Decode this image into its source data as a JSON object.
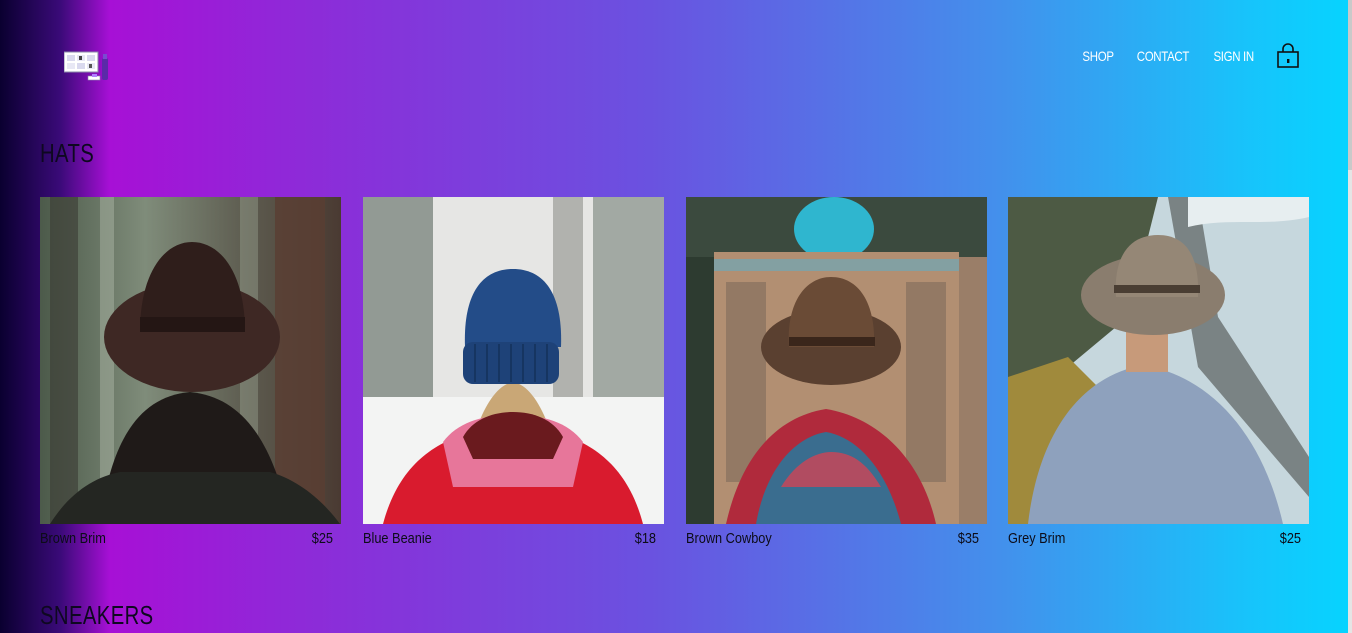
{
  "nav": {
    "shop": "SHOP",
    "contact": "CONTACT",
    "sign_in": "SIGN IN",
    "bag_icon": "shopping-bag-icon"
  },
  "logo": {
    "icon": "storefront-logo-icon"
  },
  "sections": [
    {
      "title": "HATS",
      "items": [
        {
          "name": "Brown Brim",
          "price": "$25"
        },
        {
          "name": "Blue Beanie",
          "price": "$18"
        },
        {
          "name": "Brown Cowboy",
          "price": "$35"
        },
        {
          "name": "Grey Brim",
          "price": "$25"
        }
      ]
    },
    {
      "title": "SNEAKERS",
      "items": []
    }
  ],
  "colors": {
    "gradient_left": "#0a0030",
    "gradient_purple": "#a710d6",
    "gradient_right": "#06d4ff",
    "nav_text": "#ffffff"
  }
}
